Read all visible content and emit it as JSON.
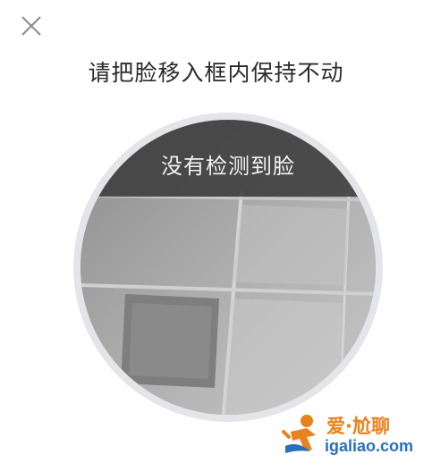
{
  "header": {
    "close_icon": "close-icon",
    "instruction": "请把脸移入框内保持不动"
  },
  "camera": {
    "status_text": "没有检测到脸"
  },
  "watermark": {
    "title": "爱·尬聊",
    "url": "igaliao.com"
  },
  "colors": {
    "status_band": "#3c3c3c",
    "ring": "#e3e5e8",
    "watermark_orange": "#e8821c",
    "watermark_blue": "#2a70b8"
  }
}
